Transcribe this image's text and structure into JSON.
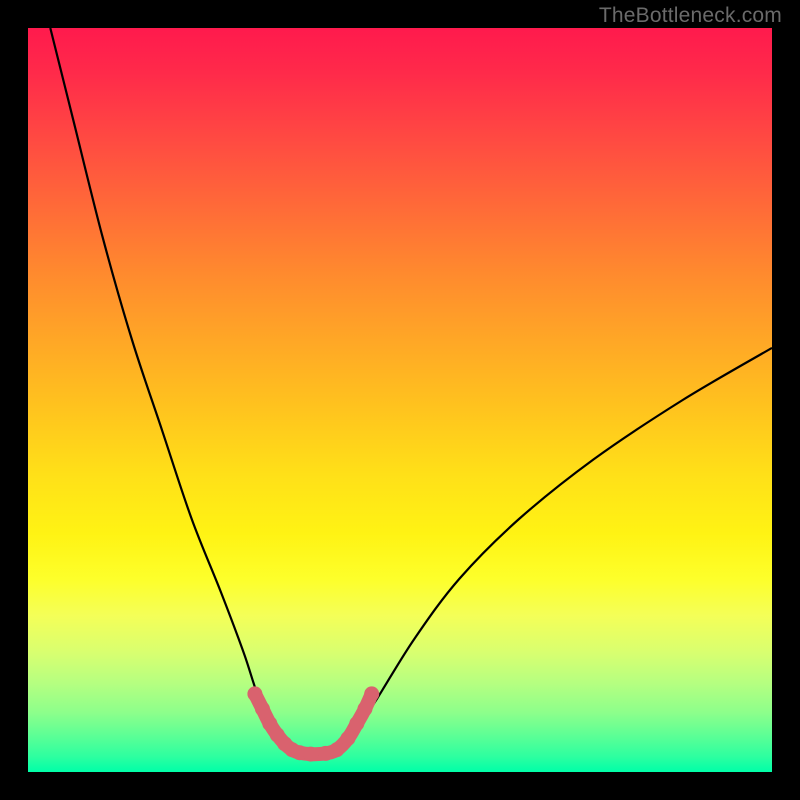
{
  "watermark": {
    "text": "TheBottleneck.com"
  },
  "chart_data": {
    "type": "line",
    "title": "",
    "xlabel": "",
    "ylabel": "",
    "xlim": [
      0,
      100
    ],
    "ylim": [
      0,
      100
    ],
    "grid": false,
    "legend": false,
    "series": [
      {
        "name": "bottleneck-curve",
        "x": [
          3,
          6,
          10,
          14,
          18,
          22,
          26,
          29,
          31,
          33,
          34.5,
          36,
          38,
          40,
          42,
          44,
          47,
          52,
          58,
          66,
          76,
          88,
          100
        ],
        "y": [
          100,
          88,
          72,
          58,
          46,
          34,
          24,
          16,
          10,
          6,
          3.5,
          2.5,
          2.4,
          2.6,
          3.2,
          5.5,
          10,
          18,
          26,
          34,
          42,
          50,
          57
        ]
      }
    ],
    "highlight": {
      "name": "minimum-zone",
      "x": [
        30.5,
        31.5,
        32.5,
        33.5,
        34.5,
        35.5,
        36.5,
        38,
        40,
        41.5,
        43,
        44.2,
        45.3,
        46.2
      ],
      "y": [
        10.5,
        8.5,
        6.5,
        5,
        3.8,
        3,
        2.6,
        2.4,
        2.5,
        3,
        4.5,
        6.5,
        8.5,
        10.5
      ]
    },
    "background": {
      "type": "vertical-gradient",
      "meaning": "low-y=good(green), high-y=bad(red)",
      "stops": [
        {
          "pos": 0.0,
          "color": "#00ffa8"
        },
        {
          "pos": 0.15,
          "color": "#8dff8b"
        },
        {
          "pos": 0.3,
          "color": "#fdff2a"
        },
        {
          "pos": 0.55,
          "color": "#ffc31e"
        },
        {
          "pos": 0.8,
          "color": "#ff6a38"
        },
        {
          "pos": 1.0,
          "color": "#ff1a4d"
        }
      ]
    }
  }
}
